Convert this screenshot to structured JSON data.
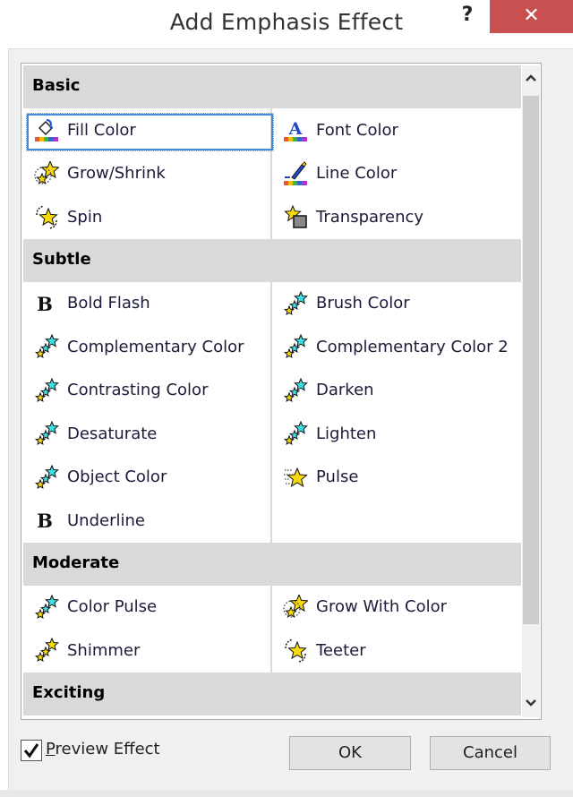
{
  "window": {
    "title": "Add Emphasis Effect",
    "help_label": "?",
    "close_label": "✕"
  },
  "groups": [
    {
      "name": "Basic",
      "left": [
        {
          "label": "Fill Color",
          "icon": "fill-bucket-icon",
          "selected": true
        },
        {
          "label": "Grow/Shrink",
          "icon": "grow-shrink-star-icon"
        },
        {
          "label": "Spin",
          "icon": "spin-star-icon"
        }
      ],
      "right": [
        {
          "label": "Font Color",
          "icon": "font-color-icon"
        },
        {
          "label": "Line Color",
          "icon": "line-color-pen-icon"
        },
        {
          "label": "Transparency",
          "icon": "transparency-star-icon"
        }
      ]
    },
    {
      "name": "Subtle",
      "left": [
        {
          "label": "Bold Flash",
          "icon": "bold-b-icon"
        },
        {
          "label": "Complementary Color",
          "icon": "cyan-stars-icon"
        },
        {
          "label": "Contrasting Color",
          "icon": "cyan-stars-icon"
        },
        {
          "label": "Desaturate",
          "icon": "cyan-stars-icon"
        },
        {
          "label": "Object Color",
          "icon": "cyan-stars-icon"
        },
        {
          "label": "Underline",
          "icon": "bold-b-icon"
        }
      ],
      "right": [
        {
          "label": "Brush Color",
          "icon": "cyan-stars-icon"
        },
        {
          "label": "Complementary Color 2",
          "icon": "cyan-stars-icon"
        },
        {
          "label": "Darken",
          "icon": "cyan-stars-icon"
        },
        {
          "label": "Lighten",
          "icon": "cyan-stars-icon"
        },
        {
          "label": "Pulse",
          "icon": "pulse-star-icon"
        }
      ]
    },
    {
      "name": "Moderate",
      "left": [
        {
          "label": "Color Pulse",
          "icon": "cyan-stars-icon"
        },
        {
          "label": "Shimmer",
          "icon": "yellow-stars-icon"
        }
      ],
      "right": [
        {
          "label": "Grow With Color",
          "icon": "grow-shrink-star-icon"
        },
        {
          "label": "Teeter",
          "icon": "spin-star-icon"
        }
      ]
    },
    {
      "name": "Exciting",
      "left": [],
      "right": []
    }
  ],
  "scrollbar": {
    "up_label": "˄",
    "down_label": "˅"
  },
  "footer": {
    "preview_checked": true,
    "preview_label_mnemonic": "P",
    "preview_label_rest": "review Effect",
    "ok_label": "OK",
    "cancel_label": "Cancel"
  },
  "colors": {
    "close_button": "#c75050",
    "selection_border": "#3c8ee0",
    "group_header_bg": "#d9d9dc"
  }
}
